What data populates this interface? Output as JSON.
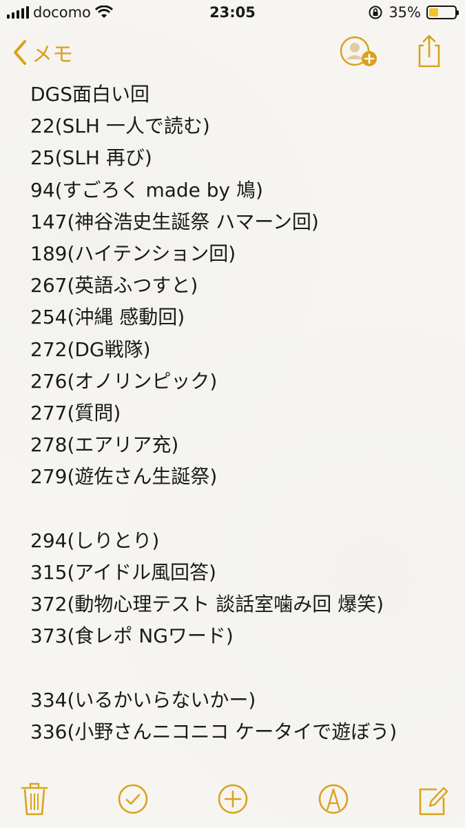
{
  "status_bar": {
    "carrier": "docomo",
    "time": "23:05",
    "battery_percent": "35%",
    "battery_level": 0.35,
    "icons": [
      "signal-icon",
      "wifi-icon",
      "orientation-lock-icon",
      "battery-icon"
    ]
  },
  "nav": {
    "back_label": "メモ",
    "icons": [
      "chevron-left-icon",
      "add-person-icon",
      "share-icon"
    ]
  },
  "note": {
    "lines": [
      "DGS面白い回",
      "22(SLH 一人で読む)",
      "25(SLH 再び)",
      "94(すごろく made by 鳩)",
      "147(神谷浩史生誕祭 ハマーン回)",
      "189(ハイテンション回)",
      "267(英語ふつすと)",
      "254(沖縄 感動回)",
      "272(DG戦隊)",
      "276(オノリンピック)",
      "277(質問)",
      "278(エアリア充)",
      "279(遊佐さん生誕祭)",
      "",
      "294(しりとり)",
      "315(アイドル風回答)",
      "372(動物心理テスト 談話室噛み回 爆笑)",
      "373(食レポ NGワード)",
      "",
      "334(いるかいらないかー)",
      "336(小野さんニコニコ ケータイで遊ぼう)"
    ]
  },
  "toolbar": {
    "icons": [
      "trash-icon",
      "checklist-icon",
      "add-icon",
      "sketch-icon",
      "compose-icon"
    ]
  },
  "colors": {
    "accent": "#d9a21a",
    "battery": "#f1c32b",
    "paper": "#f6f5f1",
    "text": "#1a1a1a"
  }
}
